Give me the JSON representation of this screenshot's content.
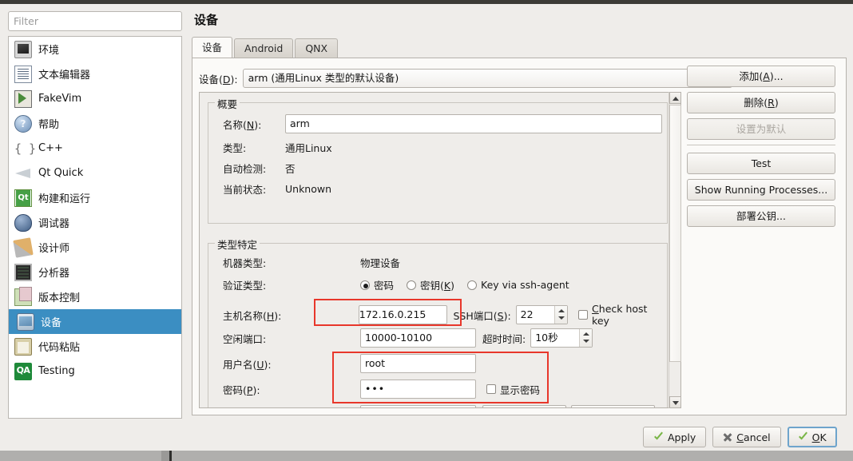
{
  "sidebar": {
    "filter_placeholder": "Filter",
    "items": [
      {
        "label": "环境",
        "icon": "monitor-icon"
      },
      {
        "label": "文本编辑器",
        "icon": "text-document-icon"
      },
      {
        "label": "FakeVim",
        "icon": "fakevim-icon"
      },
      {
        "label": "帮助",
        "icon": "help-question-icon"
      },
      {
        "label": "C++",
        "icon": "braces-icon"
      },
      {
        "label": "Qt Quick",
        "icon": "paper-plane-icon"
      },
      {
        "label": "构建和运行",
        "icon": "qt-build-icon"
      },
      {
        "label": "调试器",
        "icon": "bug-icon"
      },
      {
        "label": "设计师",
        "icon": "brush-ruler-icon"
      },
      {
        "label": "分析器",
        "icon": "analyzer-screen-icon"
      },
      {
        "label": "版本控制",
        "icon": "documents-icon"
      },
      {
        "label": "设备",
        "icon": "device-phone-icon"
      },
      {
        "label": "代码粘贴",
        "icon": "clipboard-globe-icon"
      },
      {
        "label": "Testing",
        "icon": "qa-icon"
      }
    ],
    "selected_index": 11
  },
  "main": {
    "title": "设备",
    "tabs": [
      {
        "label": "设备",
        "active": true
      },
      {
        "label": "Android",
        "active": false
      },
      {
        "label": "QNX",
        "active": false
      }
    ],
    "device_row": {
      "label": "设备(D):",
      "label_plain": "设备(",
      "label_mnemonic": "D",
      "label_tail": "):",
      "value": "arm (通用Linux 类型的默认设备)"
    },
    "summary": {
      "group_title": "概要",
      "name_label_plain": "名称(",
      "name_label_mnemonic": "N",
      "name_label_tail": "):",
      "name_value": "arm",
      "rows": [
        {
          "label": "类型:",
          "value": "通用Linux"
        },
        {
          "label": "自动检测:",
          "value": "否"
        },
        {
          "label": "当前状态:",
          "value": "Unknown"
        }
      ]
    },
    "type_specific": {
      "group_title": "类型特定",
      "machine_type_label": "机器类型:",
      "machine_type_value": "物理设备",
      "auth_label": "验证类型:",
      "auth_options": [
        {
          "plain": "密码",
          "mnemonic": "",
          "tail": "",
          "selected": true
        },
        {
          "plain": "密钥(",
          "mnemonic": "K",
          "tail": ")",
          "selected": false
        },
        {
          "plain": "Key via ssh-agent",
          "mnemonic": "",
          "tail": "",
          "selected": false
        }
      ],
      "host_label_plain": "主机名称(",
      "host_label_mnemonic": "H",
      "host_label_tail": "):",
      "host_value": "172.16.0.215",
      "ssh_port_label_plain": "SSH端口(",
      "ssh_port_label_mnemonic": "S",
      "ssh_port_label_tail": "):",
      "ssh_port_value": "22",
      "check_host_key_plain": "",
      "check_host_key_mnemonic": "C",
      "check_host_key_tail": "heck host key",
      "free_ports_label": "空闲端口:",
      "free_ports_value": "10000-10100",
      "timeout_label": "超时时间:",
      "timeout_value": "10秒",
      "username_label_plain": "用户名(",
      "username_label_mnemonic": "U",
      "username_label_tail": "):",
      "username_value": "root",
      "password_label_plain": "密码(",
      "password_label_mnemonic": "P",
      "password_label_tail": "):",
      "password_value": "•••",
      "show_password_label": "显示密码"
    }
  },
  "side_buttons": [
    {
      "label": "添加(A)...",
      "plain": "添加(",
      "mnemonic": "A",
      "tail": ")...",
      "disabled": false
    },
    {
      "label": "删除(R)",
      "plain": "删除(",
      "mnemonic": "R",
      "tail": ")",
      "disabled": false
    },
    {
      "label": "设置为默认",
      "plain": "设置为默认",
      "mnemonic": "",
      "tail": "",
      "disabled": true
    },
    {
      "label": "Test",
      "plain": "Test",
      "mnemonic": "",
      "tail": "",
      "disabled": false
    },
    {
      "label": "Show Running Processes...",
      "plain": "Show Running Processes...",
      "mnemonic": "",
      "tail": "",
      "disabled": false
    },
    {
      "label": "部署公钥...",
      "plain": "部署公钥...",
      "mnemonic": "",
      "tail": "",
      "disabled": false
    }
  ],
  "dialog_buttons": [
    {
      "label": "Apply",
      "plain": "Apply",
      "mnemonic": "",
      "tail": "",
      "icon": "check-icon",
      "default": false
    },
    {
      "label": "Cancel",
      "plain": "",
      "mnemonic": "C",
      "tail": "ancel",
      "icon": "x-icon",
      "default": false
    },
    {
      "label": "OK",
      "plain": "",
      "mnemonic": "O",
      "tail": "K",
      "icon": "check-icon",
      "default": true
    }
  ],
  "colors": {
    "selection_blue": "#3b8ec2",
    "highlight_red": "#e8372b",
    "panel_bg": "#fbfaf8",
    "window_bg": "#efedea"
  }
}
